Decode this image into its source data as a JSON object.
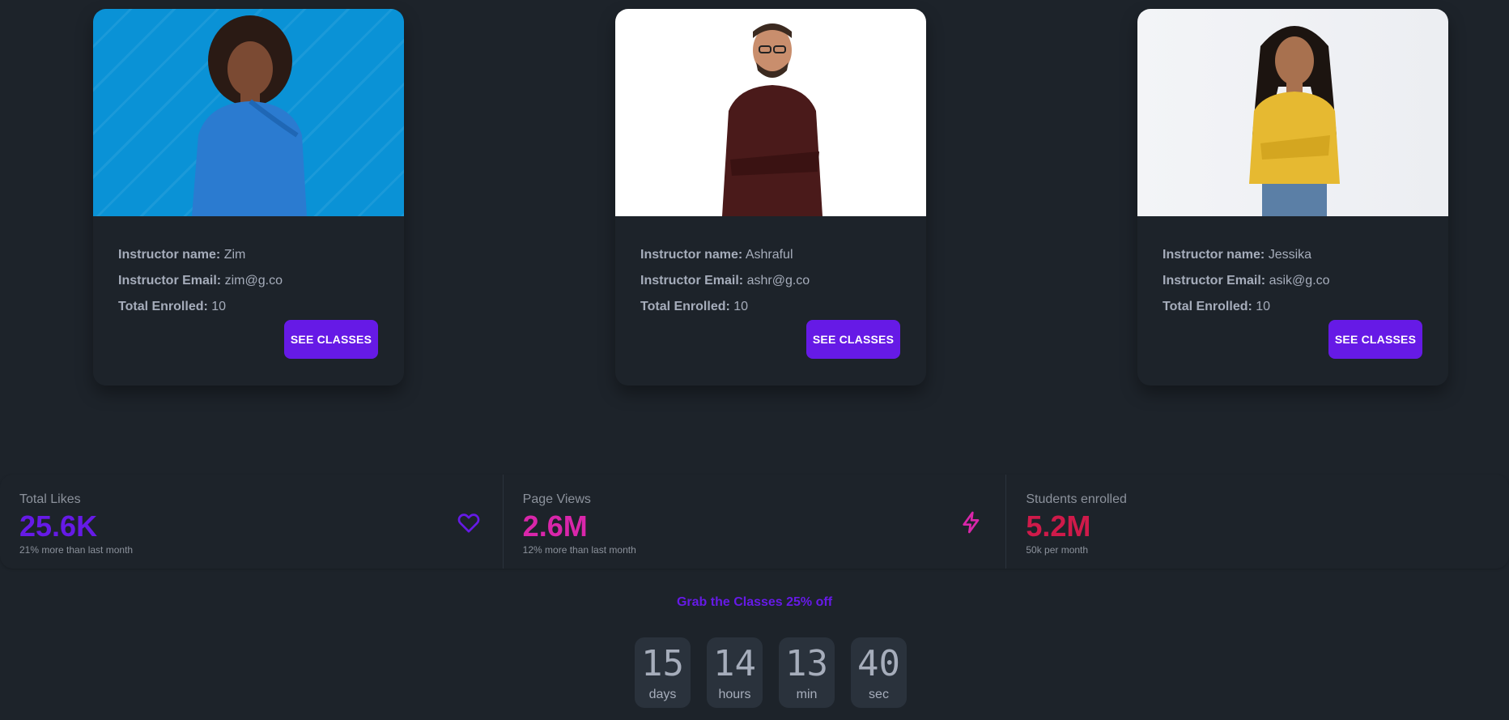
{
  "instructors": [
    {
      "name_label": "Instructor name:",
      "name": "Zim",
      "email_label": "Instructor Email:",
      "email": "zim@g.co",
      "enrolled_label": "Total Enrolled:",
      "enrolled": "10",
      "button": "SEE CLASSES"
    },
    {
      "name_label": "Instructor name:",
      "name": "Ashraful",
      "email_label": "Instructor Email:",
      "email": "ashr@g.co",
      "enrolled_label": "Total Enrolled:",
      "enrolled": "10",
      "button": "SEE CLASSES"
    },
    {
      "name_label": "Instructor name:",
      "name": "Jessika",
      "email_label": "Instructor Email:",
      "email": "asik@g.co",
      "enrolled_label": "Total Enrolled:",
      "enrolled": "10",
      "button": "SEE CLASSES"
    }
  ],
  "stats": [
    {
      "title": "Total Likes",
      "value": "25.6K",
      "desc": "21% more than last month",
      "color": "#661ae6",
      "icon": "heart-icon"
    },
    {
      "title": "Page Views",
      "value": "2.6M",
      "desc": "12% more than last month",
      "color": "#d926aa",
      "icon": "bolt-icon"
    },
    {
      "title": "Students enrolled",
      "value": "5.2M",
      "desc": "50k per month",
      "color": "#cf1a4a"
    }
  ],
  "promo": "Grab the Classes 25% off",
  "countdown": [
    {
      "value": "15",
      "label": "days"
    },
    {
      "value": "14",
      "label": "hours"
    },
    {
      "value": "13",
      "label": "min"
    },
    {
      "value": "40",
      "label": "sec"
    }
  ],
  "colors": {
    "accent": "#661ae6",
    "background": "#1d232a",
    "card_bg": "#2a323c"
  }
}
